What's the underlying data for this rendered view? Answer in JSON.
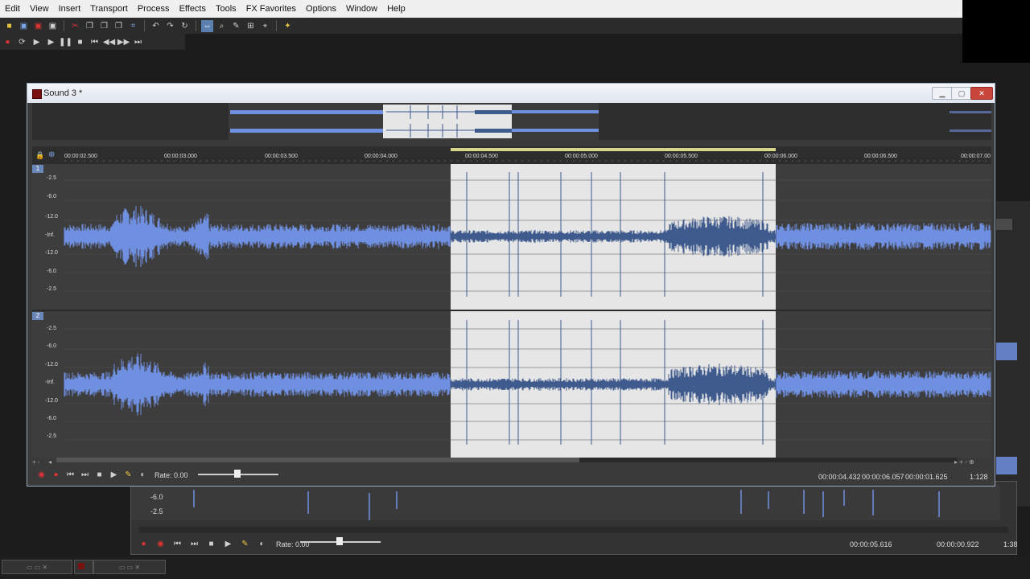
{
  "menu": [
    "Edit",
    "View",
    "Insert",
    "Transport",
    "Process",
    "Effects",
    "Tools",
    "FX Favorites",
    "Options",
    "Window",
    "Help"
  ],
  "window": {
    "title": "Sound 3 *",
    "rate_label": "Rate: 0.00",
    "sel_start": "00:00:04.432",
    "sel_end": "00:00:06.057",
    "sel_length": "00:00:01.625",
    "zoom": "1:128"
  },
  "ruler_ticks": [
    "00:00:02.500",
    "00:00:03.000",
    "00:00:03.500",
    "00:00:04.000",
    "00:00:04.500",
    "00:00:05.000",
    "00:00:05.500",
    "00:00:06.000",
    "00:00:06.500",
    "00:00:07.00"
  ],
  "db_labels": [
    "-2.5",
    "-6.0",
    "-12.0",
    "-Inf.",
    "-12.0",
    "-6.0",
    "-2.5"
  ],
  "track_numbers": [
    "1",
    "2"
  ],
  "background_window": {
    "rate_label": "Rate: 0.00",
    "sel_end": "00:00:05.616",
    "sel_length": "00:00:00.922",
    "zoom": "1:38",
    "db_labels": [
      "-6.0",
      "-2.5"
    ]
  },
  "colors": {
    "waveform": "#6f8fe0",
    "waveform_selected": "#3f5a8c",
    "selection_bg": "#e6e6e6",
    "track_bg": "#3d3d3d"
  }
}
